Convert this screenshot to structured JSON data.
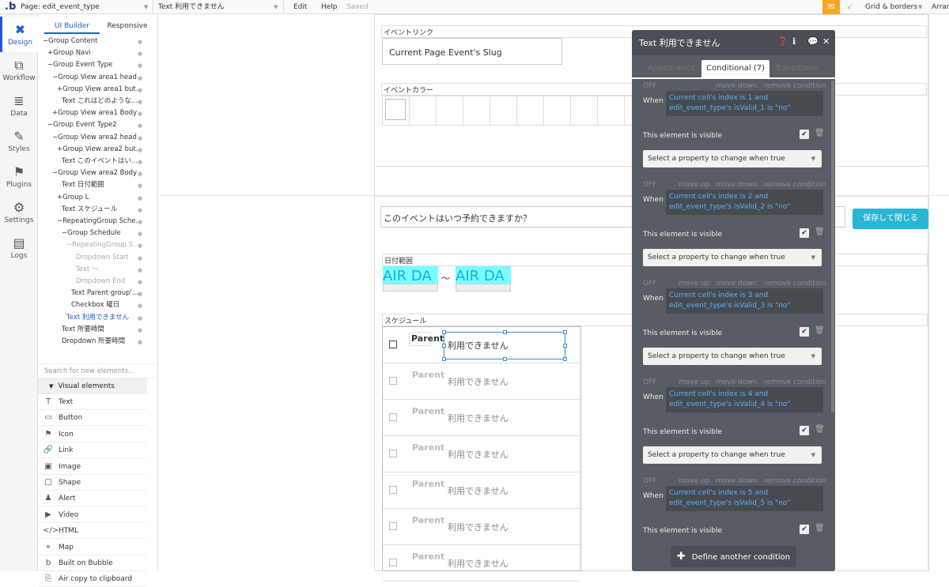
{
  "topbar": {
    "page_label": "Page: edit_event_type",
    "element_label": "Text 利用できません",
    "menu": [
      "Edit",
      "Help"
    ],
    "saved": "Saved",
    "grid": "Grid & borders",
    "arrange": "Arran"
  },
  "rail": [
    {
      "icon": "design-icon",
      "glyph": "✖",
      "label": "Design",
      "active": true
    },
    {
      "icon": "workflow-icon",
      "glyph": "⧉",
      "label": "Workflow",
      "active": false
    },
    {
      "icon": "data-icon",
      "glyph": "≣",
      "label": "Data",
      "active": false
    },
    {
      "icon": "styles-icon",
      "glyph": "✎",
      "label": "Styles",
      "active": false
    },
    {
      "icon": "plugins-icon",
      "glyph": "⚑",
      "label": "Plugins",
      "active": false
    },
    {
      "icon": "settings-icon",
      "glyph": "⚙",
      "label": "Settings",
      "active": false
    },
    {
      "icon": "logs-icon",
      "glyph": "▤",
      "label": "Logs",
      "active": false
    }
  ],
  "left_tabs": {
    "ui_builder": "UI Builder",
    "responsive": "Responsive"
  },
  "tree": [
    {
      "text": "−Group Content",
      "indent": 0,
      "state": "normal"
    },
    {
      "text": "+Group Navi",
      "indent": 1,
      "state": "normal"
    },
    {
      "text": "−Group Event Type",
      "indent": 1,
      "state": "normal"
    },
    {
      "text": "−Group View area1 head",
      "indent": 2,
      "state": "normal"
    },
    {
      "text": "+Group View area1 but...",
      "indent": 3,
      "state": "normal"
    },
    {
      "text": "Text これはどのような...",
      "indent": 4,
      "state": "normal"
    },
    {
      "text": "+Group View area1 Body",
      "indent": 2,
      "state": "normal"
    },
    {
      "text": "−Group Event Type2",
      "indent": 1,
      "state": "normal"
    },
    {
      "text": "−Group View area2 head",
      "indent": 2,
      "state": "normal"
    },
    {
      "text": "+Group View area2 but...",
      "indent": 3,
      "state": "normal"
    },
    {
      "text": "Text このイベントはい...",
      "indent": 4,
      "state": "normal"
    },
    {
      "text": "−Group View area2 Body",
      "indent": 2,
      "state": "normal"
    },
    {
      "text": "Text 日付範囲",
      "indent": 4,
      "state": "normal"
    },
    {
      "text": "+Group L",
      "indent": 3,
      "state": "normal"
    },
    {
      "text": "Text スケジュール",
      "indent": 4,
      "state": "normal"
    },
    {
      "text": "−RepeatingGroup Sche...",
      "indent": 3,
      "state": "normal"
    },
    {
      "text": "−Group Schedule",
      "indent": 4,
      "state": "normal"
    },
    {
      "text": "−RepeatingGroup S...",
      "indent": 5,
      "state": "dim"
    },
    {
      "text": "Dropdown Start",
      "indent": 7,
      "state": "dim"
    },
    {
      "text": "Text 〜",
      "indent": 7,
      "state": "dim"
    },
    {
      "text": "Dropdown End",
      "indent": 7,
      "state": "dim"
    },
    {
      "text": "Text Parent group'...",
      "indent": 6,
      "state": "normal"
    },
    {
      "text": "Checkbox 曜日",
      "indent": 6,
      "state": "normal"
    },
    {
      "text": "Text 利用できません",
      "indent": 5,
      "state": "sel"
    },
    {
      "text": "Text 所要時間",
      "indent": 4,
      "state": "normal"
    },
    {
      "text": "Dropdown 所要時間",
      "indent": 4,
      "state": "normal"
    }
  ],
  "search_placeholder": "Search for new elements...",
  "visual_header": "Visual elements",
  "visual_items": [
    {
      "icon": "text-icon",
      "glyph": "T",
      "label": "Text"
    },
    {
      "icon": "button-icon",
      "glyph": "▭",
      "label": "Button"
    },
    {
      "icon": "flag-icon",
      "glyph": "⚑",
      "label": "Icon"
    },
    {
      "icon": "link-icon",
      "glyph": "🔗",
      "label": "Link"
    },
    {
      "icon": "image-icon",
      "glyph": "▣",
      "label": "Image"
    },
    {
      "icon": "shape-icon",
      "glyph": "□",
      "label": "Shape"
    },
    {
      "icon": "alert-icon",
      "glyph": "♟",
      "label": "Alert"
    },
    {
      "icon": "video-icon",
      "glyph": "▶",
      "label": "Video"
    },
    {
      "icon": "html-icon",
      "glyph": "</>",
      "label": "HTML"
    },
    {
      "icon": "map-icon",
      "glyph": "⌖",
      "label": "Map"
    },
    {
      "icon": "bubble-icon",
      "glyph": "b",
      "label": "Built on Bubble"
    },
    {
      "icon": "clipboard-icon",
      "glyph": "⎘",
      "label": "Air copy to clipboard"
    }
  ],
  "canvas": {
    "event_link_label": "イベントリンク",
    "event_link_value": "Current Page Event's Slug",
    "event_color_label": "イベントカラー",
    "question": "このイベントはいつ予約できますか？",
    "save_button": "保存して閉じる",
    "date_range_label": "日付範囲",
    "air_text": "AIR DA",
    "tilde": "〜",
    "schedule_label": "スケジュール",
    "parent_text": "Parent",
    "row_text": "利用できません"
  },
  "popup": {
    "title": "Text 利用できません",
    "tabs": [
      "Appearance",
      "Conditional (7)",
      "Transitions"
    ],
    "conditions": [
      {
        "off": "OFF",
        "move_up": "",
        "move_down": "move down",
        "remove": "remove condition",
        "when": "When",
        "expr1": "Current cell's index is 1 and",
        "expr2": "edit_event_type's isValid_1 is \"no\"",
        "visible": "This element is visible",
        "select": "Select a property to change when true"
      },
      {
        "off": "OFF",
        "move_up": "move up",
        "move_down": "move down",
        "remove": "remove condition",
        "when": "When",
        "expr1": "Current cell's index is 2 and",
        "expr2": "edit_event_type's isValid_2 is \"no\"",
        "visible": "This element is visible",
        "select": "Select a property to change when true"
      },
      {
        "off": "OFF",
        "move_up": "move up",
        "move_down": "move down",
        "remove": "remove condition",
        "when": "When",
        "expr1": "Current cell's index is 3 and",
        "expr2": "edit_event_type's isValid_3 is \"no\"",
        "visible": "This element is visible",
        "select": "Select a property to change when true"
      },
      {
        "off": "OFF",
        "move_up": "move up",
        "move_down": "move down",
        "remove": "remove condition",
        "when": "When",
        "expr1": "Current cell's index is 4 and",
        "expr2": "edit_event_type's isValid_4 is \"no\"",
        "visible": "This element is visible",
        "select": "Select a property to change when true"
      },
      {
        "off": "OFF",
        "move_up": "move up",
        "move_down": "move down",
        "remove": "remove condition",
        "when": "When",
        "expr1": "Current cell's index is 5 and",
        "expr2": "edit_event_type's isValid_5 is \"no\"",
        "visible": "This element is visible",
        "select": ""
      }
    ],
    "define_button": "Define another condition"
  },
  "colors": {
    "accent": "#1f5ad6",
    "save": "#29b6d3",
    "popup": "#585d63",
    "cyan": "#77ffff"
  }
}
